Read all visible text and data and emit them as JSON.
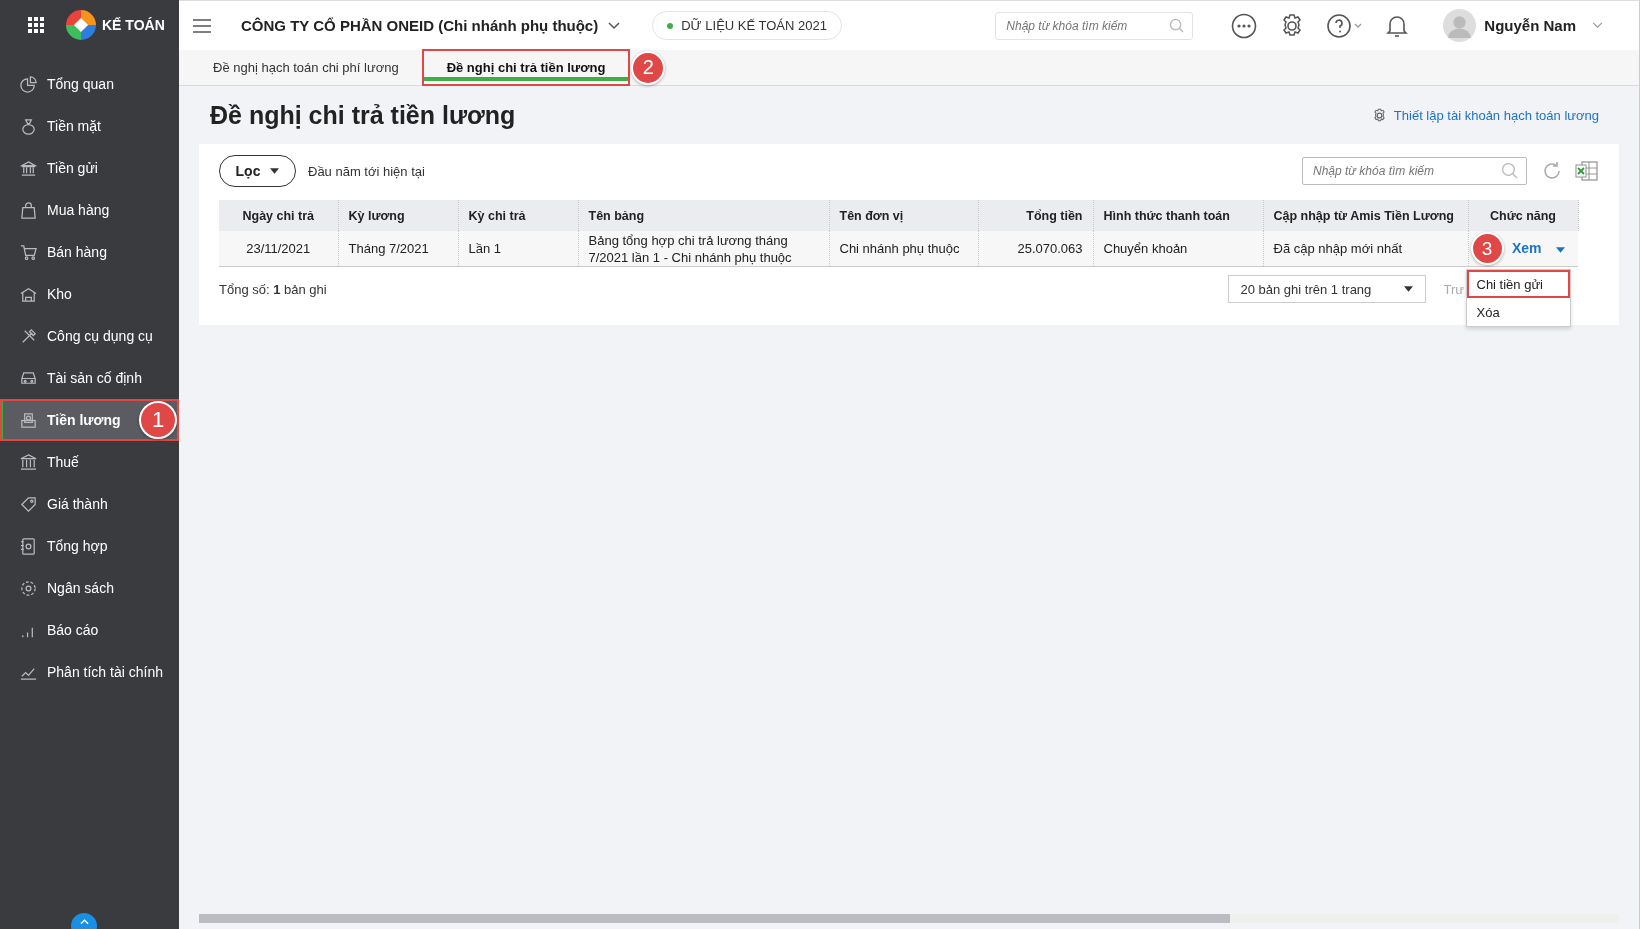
{
  "app": {
    "name": "KẾ TOÁN"
  },
  "sidebar": {
    "items": [
      {
        "label": "Tổng quan",
        "selected": false
      },
      {
        "label": "Tiền mặt",
        "selected": false
      },
      {
        "label": "Tiền gửi",
        "selected": false
      },
      {
        "label": "Mua hàng",
        "selected": false
      },
      {
        "label": "Bán hàng",
        "selected": false
      },
      {
        "label": "Kho",
        "selected": false
      },
      {
        "label": "Công cụ dụng cụ",
        "selected": false
      },
      {
        "label": "Tài sản cố định",
        "selected": false
      },
      {
        "label": "Tiền lương",
        "selected": true,
        "callout": "1"
      },
      {
        "label": "Thuế",
        "selected": false
      },
      {
        "label": "Giá thành",
        "selected": false
      },
      {
        "label": "Tổng hợp",
        "selected": false
      },
      {
        "label": "Ngân sách",
        "selected": false
      },
      {
        "label": "Báo cáo",
        "selected": false
      },
      {
        "label": "Phân tích tài chính",
        "selected": false
      }
    ]
  },
  "header": {
    "company": "CÔNG TY CỔ PHẦN ONEID (Chi nhánh phụ thuộc)",
    "data_badge": "DỮ LIỆU KẾ TOÁN 2021",
    "search": {
      "placeholder": "Nhập từ khóa tìm kiếm"
    },
    "user": "Nguyễn Nam"
  },
  "tabs": [
    {
      "label": "Đề nghị hạch toán chi phí lương",
      "selected": false
    },
    {
      "label": "Đề nghị chi trả tiền lương",
      "selected": true,
      "callout": "2"
    }
  ],
  "page": {
    "title": "Đề nghị chi trả tiền lương",
    "settings_link": "Thiết lập tài khoản hạch toán lương"
  },
  "toolbar": {
    "filter_button": "Lọc",
    "period": "Đầu năm tới hiện tại",
    "search": {
      "placeholder": "Nhập từ khóa tìm kiếm"
    }
  },
  "table": {
    "columns": [
      "Ngày chi trả",
      "Kỳ lương",
      "Kỳ chi trả",
      "Tên bảng",
      "Tên đơn vị",
      "Tổng tiền",
      "Hình thức thanh toán",
      "Cập nhập từ Amis Tiền Lương",
      "Chức năng"
    ],
    "rows": [
      {
        "cells": [
          "23/11/2021",
          "Tháng 7/2021",
          "Lần 1",
          "Bảng tổng hợp chi trả lương tháng 7/2021 lần 1 - Chi nhánh phụ thuộc",
          "Chi nhánh phụ thuộc",
          "25.070.063",
          "Chuyển khoản",
          "Đã cập nhập mới nhất"
        ],
        "action": "Xem"
      }
    ]
  },
  "action_menu": {
    "items": [
      {
        "label": "Chi tiền gửi",
        "callout": "3"
      },
      {
        "label": "Xóa"
      }
    ]
  },
  "footer": {
    "total": "Tổng số: **1** bản ghi",
    "page_size": "20 bản ghi trên 1 trang",
    "pager_text": "Trư"
  }
}
